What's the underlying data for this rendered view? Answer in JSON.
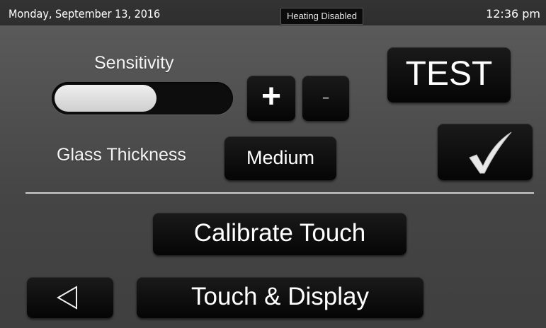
{
  "status_bar": {
    "date": "Monday, September 13, 2016",
    "heating_status": "Heating Disabled",
    "time": "12:36 pm"
  },
  "sensitivity": {
    "label": "Sensitivity",
    "level_fraction": 0.58,
    "plus_label": "+",
    "minus_label": "-"
  },
  "test_button": {
    "label": "TEST"
  },
  "confirm_button": {
    "icon": "checkmark-icon"
  },
  "glass_thickness": {
    "label": "Glass Thickness",
    "value": "Medium"
  },
  "calibrate_button": {
    "label": "Calibrate Touch"
  },
  "back_button": {
    "icon": "back-triangle-icon"
  },
  "menu_button": {
    "label": "Touch & Display"
  },
  "colors": {
    "button_bg": "#0a0a0a",
    "slider_fill": "#d9d9d9",
    "minus_disabled": "#7a7a7a",
    "divider": "#cfcfcf"
  }
}
